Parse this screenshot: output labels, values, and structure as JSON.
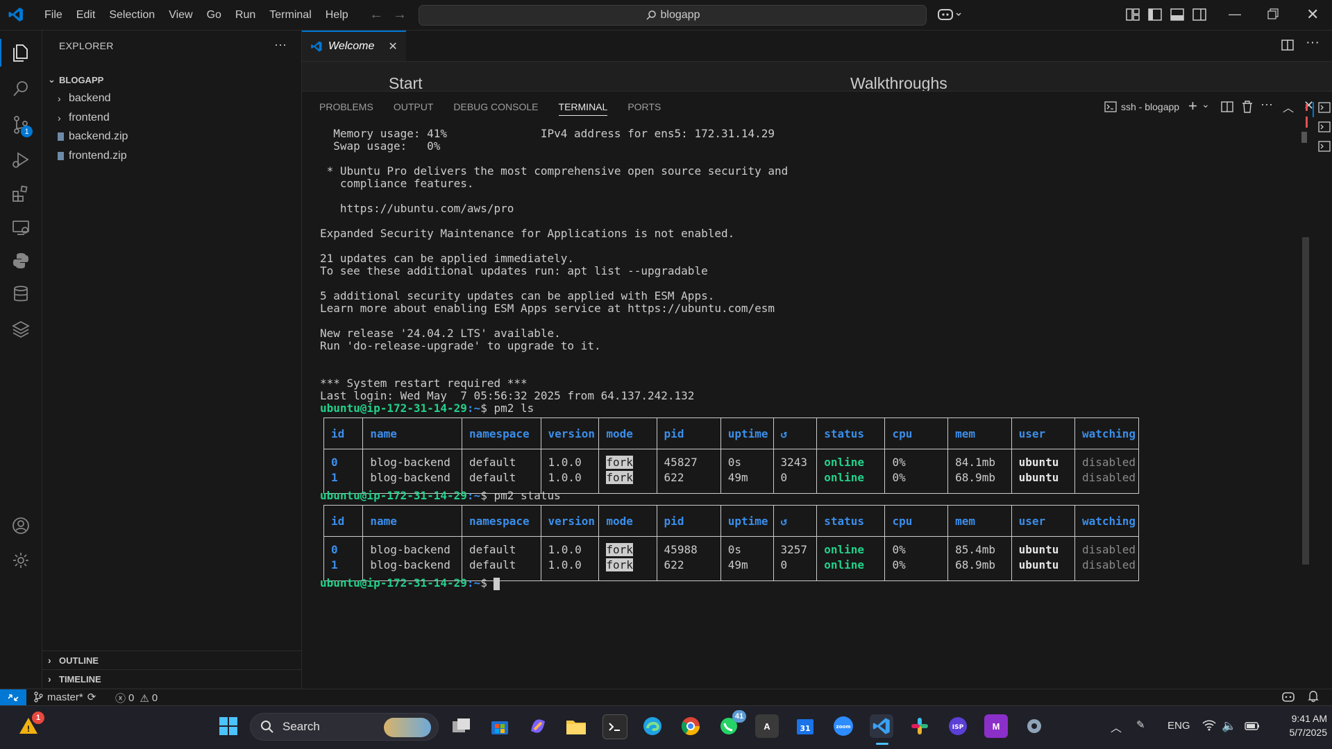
{
  "menu": [
    "File",
    "Edit",
    "Selection",
    "View",
    "Go",
    "Run",
    "Terminal",
    "Help"
  ],
  "command_center": "blogapp",
  "sidebar": {
    "title": "EXPLORER",
    "root": "BLOGAPP",
    "items": [
      {
        "label": "backend",
        "kind": "folder"
      },
      {
        "label": "frontend",
        "kind": "folder"
      },
      {
        "label": "backend.zip",
        "kind": "file"
      },
      {
        "label": "frontend.zip",
        "kind": "file"
      }
    ],
    "outline": "OUTLINE",
    "timeline": "TIMELINE"
  },
  "activity_badge": "1",
  "editor": {
    "tab_label": "Welcome",
    "start_heading": "Start",
    "walkthroughs_heading": "Walkthroughs"
  },
  "panel": {
    "tabs": [
      "PROBLEMS",
      "OUTPUT",
      "DEBUG CONSOLE",
      "TERMINAL",
      "PORTS"
    ],
    "active_tab": "TERMINAL",
    "terminal_name": "ssh - blogapp"
  },
  "terminal": {
    "lines": [
      "  Memory usage: 41%              IPv4 address for ens5: 172.31.14.29",
      "  Swap usage:   0%",
      "",
      " * Ubuntu Pro delivers the most comprehensive open source security and",
      "   compliance features.",
      "",
      "   https://ubuntu.com/aws/pro",
      "",
      "Expanded Security Maintenance for Applications is not enabled.",
      "",
      "21 updates can be applied immediately.",
      "To see these additional updates run: apt list --upgradable",
      "",
      "5 additional security updates can be applied with ESM Apps.",
      "Learn more about enabling ESM Apps service at https://ubuntu.com/esm",
      "",
      "New release '24.04.2 LTS' available.",
      "Run 'do-release-upgrade' to upgrade to it.",
      "",
      "",
      "*** System restart required ***",
      "Last login: Wed May  7 05:56:32 2025 from 64.137.242.132"
    ],
    "prompt_user": "ubuntu@ip-172-31-14-29",
    "prompt_path": ":~",
    "prompt_symbol": "$",
    "cmd1": " pm2 ls",
    "cmd2": " pm2 status",
    "columns": [
      "id",
      "name",
      "namespace",
      "version",
      "mode",
      "pid",
      "uptime",
      "↺",
      "status",
      "cpu",
      "mem",
      "user",
      "watching"
    ],
    "table1": [
      {
        "id": "0",
        "name": "blog-backend",
        "namespace": "default",
        "version": "1.0.0",
        "mode": "fork",
        "pid": "45827",
        "uptime": "0s",
        "restarts": "3243",
        "status": "online",
        "cpu": "0%",
        "mem": "84.1mb",
        "user": "ubuntu",
        "watching": "disabled"
      },
      {
        "id": "1",
        "name": "blog-backend",
        "namespace": "default",
        "version": "1.0.0",
        "mode": "fork",
        "pid": "622",
        "uptime": "49m",
        "restarts": "0",
        "status": "online",
        "cpu": "0%",
        "mem": "68.9mb",
        "user": "ubuntu",
        "watching": "disabled"
      }
    ],
    "table2": [
      {
        "id": "0",
        "name": "blog-backend",
        "namespace": "default",
        "version": "1.0.0",
        "mode": "fork",
        "pid": "45988",
        "uptime": "0s",
        "restarts": "3257",
        "status": "online",
        "cpu": "0%",
        "mem": "85.4mb",
        "user": "ubuntu",
        "watching": "disabled"
      },
      {
        "id": "1",
        "name": "blog-backend",
        "namespace": "default",
        "version": "1.0.0",
        "mode": "fork",
        "pid": "622",
        "uptime": "49m",
        "restarts": "0",
        "status": "online",
        "cpu": "0%",
        "mem": "68.9mb",
        "user": "ubuntu",
        "watching": "disabled"
      }
    ]
  },
  "statusbar": {
    "branch": "master*",
    "errors": "0",
    "warnings": "0"
  },
  "taskbar": {
    "search_label": "Search",
    "language": "ENG",
    "time": "9:41 AM",
    "date": "5/7/2025",
    "whatsapp_badge": "41",
    "alert_badge": "1"
  },
  "colors": {
    "accent": "#0078d4",
    "terminal_green": "#23d18b",
    "terminal_blue": "#3b8eea"
  }
}
